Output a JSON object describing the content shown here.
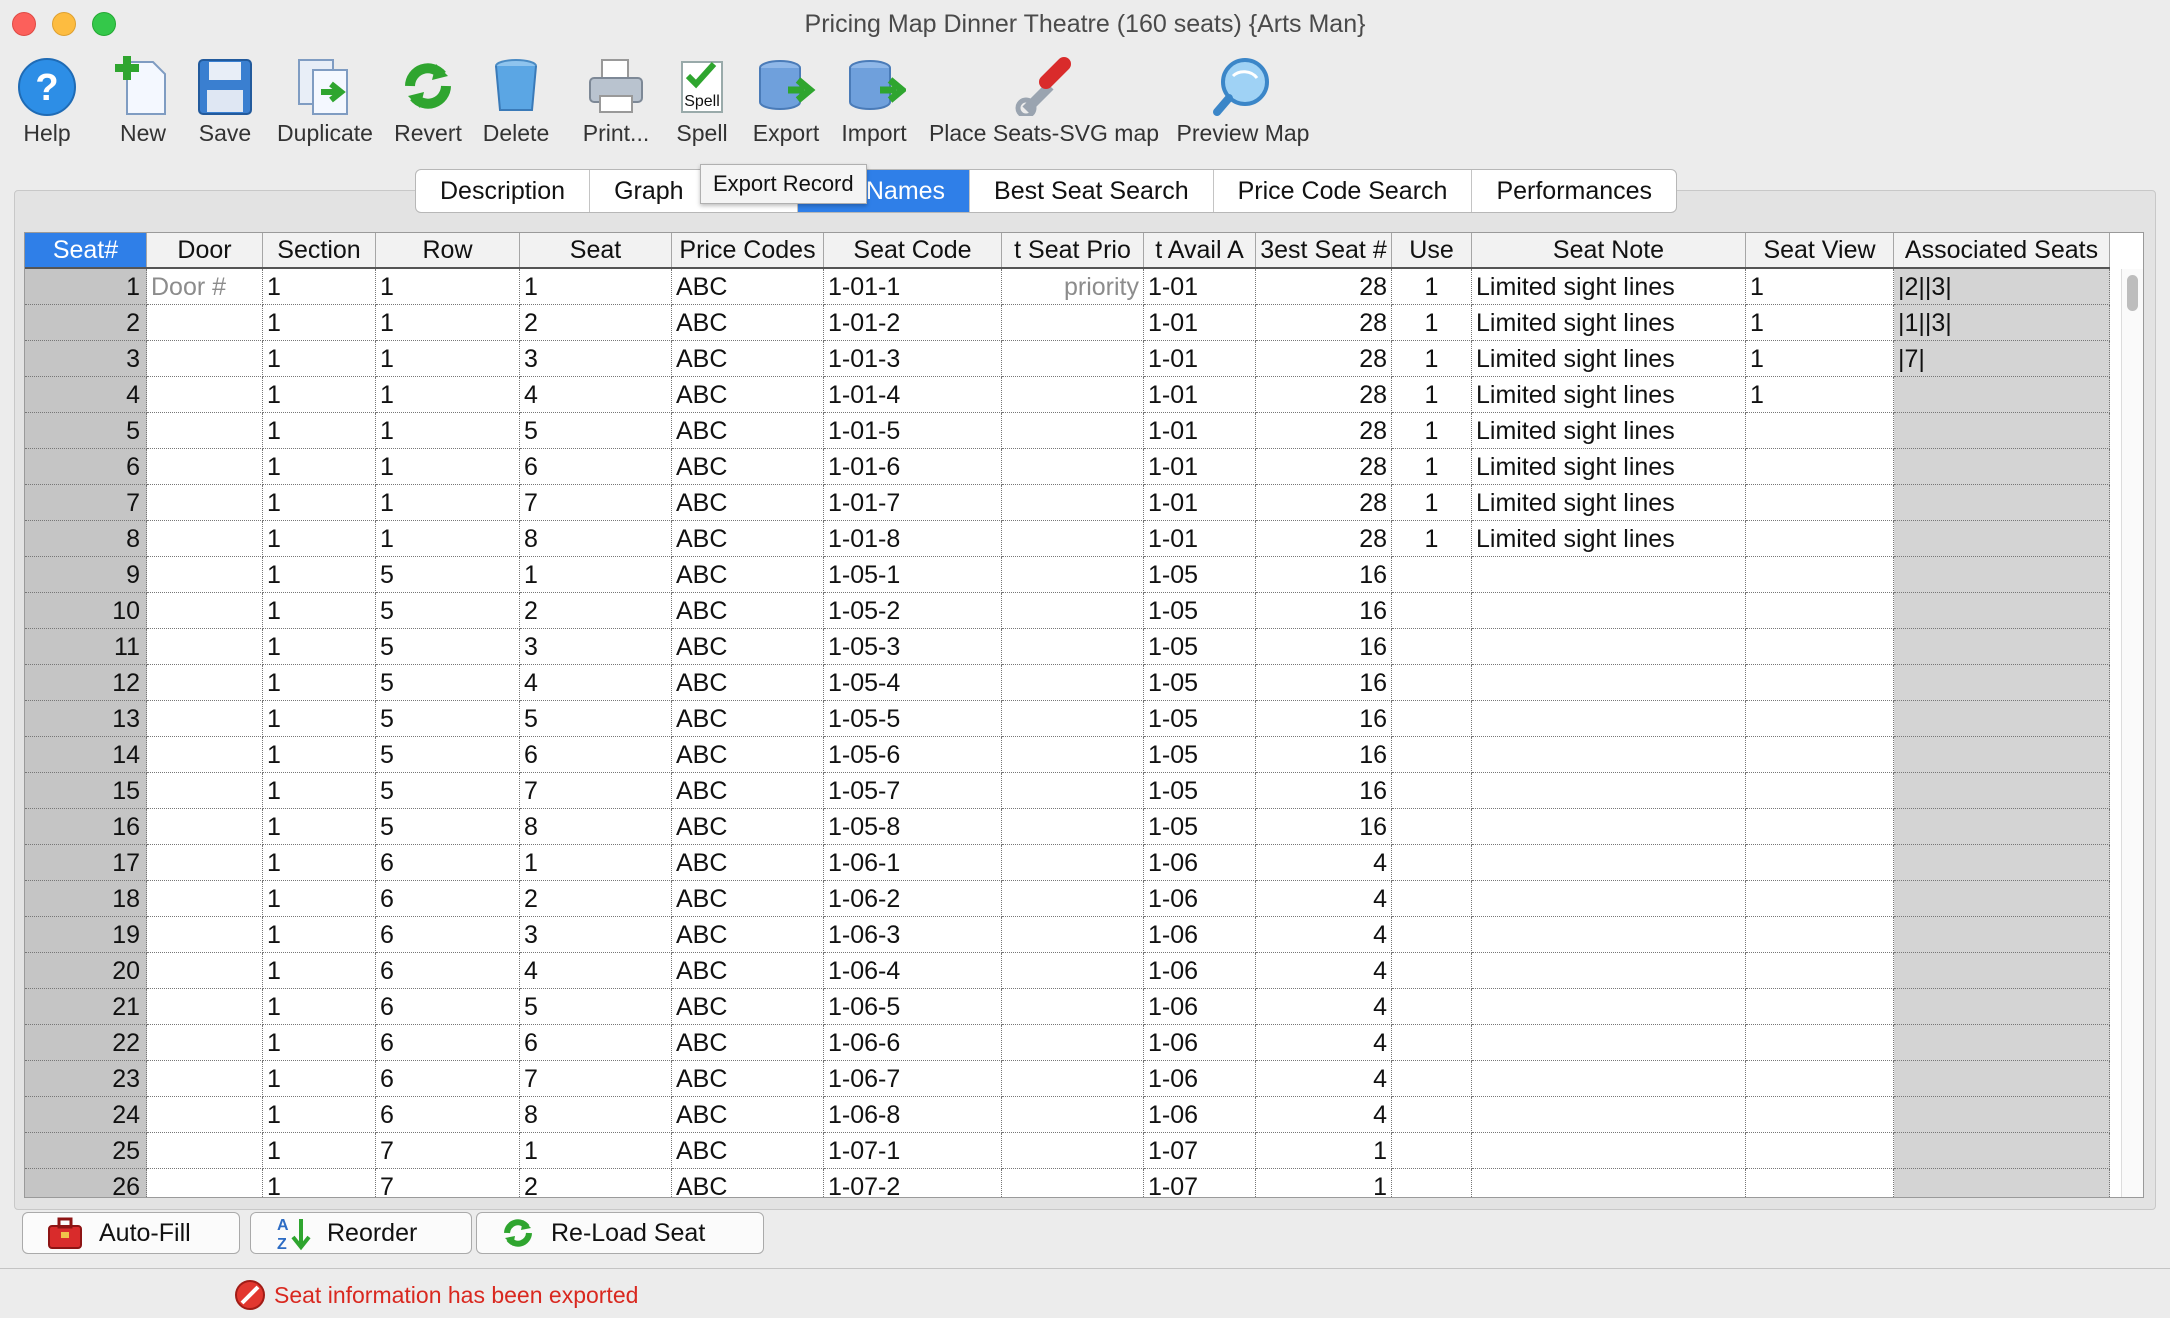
{
  "window": {
    "title": "Pricing Map Dinner Theatre (160 seats) {Arts Man}"
  },
  "toolbar": {
    "help": "Help",
    "new": "New",
    "save": "Save",
    "duplicate": "Duplicate",
    "revert": "Revert",
    "delete": "Delete",
    "print": "Print...",
    "spell": "Spell",
    "export": "Export",
    "import": "Import",
    "place_seats": "Place Seats-SVG map",
    "preview_map": "Preview Map",
    "spell_icon_text": "Spell"
  },
  "tabs": [
    "Description",
    "Graph",
    "Seat Names",
    "Best Seat Search",
    "Price Code Search",
    "Performances"
  ],
  "active_tab": "Seat Names",
  "tab_labels_visible": {
    "t0": "Description",
    "t1": "Graph",
    "t2": "at Names",
    "t3": "Best Seat Search",
    "t4": "Price Code Search",
    "t5": "Performances"
  },
  "tooltip": "Export Record",
  "grid": {
    "columns": [
      "Seat#",
      "Door",
      "Section",
      "Row",
      "Seat",
      "Price Codes",
      "Seat Code",
      "t Seat Prio",
      "t Avail A",
      "3est Seat #",
      "Use",
      "Seat Note",
      "Seat View",
      "Associated Seats"
    ],
    "placeholders": {
      "door": "Door #",
      "priority": "priority"
    },
    "rows": [
      [
        "1",
        "",
        "1",
        "1",
        "1",
        "ABC",
        "1-01-1",
        "",
        "1-01",
        "28",
        "1",
        "Limited sight lines",
        "1",
        "|2||3|"
      ],
      [
        "2",
        "",
        "1",
        "1",
        "2",
        "ABC",
        "1-01-2",
        "",
        "1-01",
        "28",
        "1",
        "Limited sight lines",
        "1",
        "|1||3|"
      ],
      [
        "3",
        "",
        "1",
        "1",
        "3",
        "ABC",
        "1-01-3",
        "",
        "1-01",
        "28",
        "1",
        "Limited sight lines",
        "1",
        "|7|"
      ],
      [
        "4",
        "",
        "1",
        "1",
        "4",
        "ABC",
        "1-01-4",
        "",
        "1-01",
        "28",
        "1",
        "Limited sight lines",
        "1",
        ""
      ],
      [
        "5",
        "",
        "1",
        "1",
        "5",
        "ABC",
        "1-01-5",
        "",
        "1-01",
        "28",
        "1",
        "Limited sight lines",
        "",
        ""
      ],
      [
        "6",
        "",
        "1",
        "1",
        "6",
        "ABC",
        "1-01-6",
        "",
        "1-01",
        "28",
        "1",
        "Limited sight lines",
        "",
        ""
      ],
      [
        "7",
        "",
        "1",
        "1",
        "7",
        "ABC",
        "1-01-7",
        "",
        "1-01",
        "28",
        "1",
        "Limited sight lines",
        "",
        ""
      ],
      [
        "8",
        "",
        "1",
        "1",
        "8",
        "ABC",
        "1-01-8",
        "",
        "1-01",
        "28",
        "1",
        "Limited sight lines",
        "",
        ""
      ],
      [
        "9",
        "",
        "1",
        "5",
        "1",
        "ABC",
        "1-05-1",
        "",
        "1-05",
        "16",
        "",
        "",
        "",
        ""
      ],
      [
        "10",
        "",
        "1",
        "5",
        "2",
        "ABC",
        "1-05-2",
        "",
        "1-05",
        "16",
        "",
        "",
        "",
        ""
      ],
      [
        "11",
        "",
        "1",
        "5",
        "3",
        "ABC",
        "1-05-3",
        "",
        "1-05",
        "16",
        "",
        "",
        "",
        ""
      ],
      [
        "12",
        "",
        "1",
        "5",
        "4",
        "ABC",
        "1-05-4",
        "",
        "1-05",
        "16",
        "",
        "",
        "",
        ""
      ],
      [
        "13",
        "",
        "1",
        "5",
        "5",
        "ABC",
        "1-05-5",
        "",
        "1-05",
        "16",
        "",
        "",
        "",
        ""
      ],
      [
        "14",
        "",
        "1",
        "5",
        "6",
        "ABC",
        "1-05-6",
        "",
        "1-05",
        "16",
        "",
        "",
        "",
        ""
      ],
      [
        "15",
        "",
        "1",
        "5",
        "7",
        "ABC",
        "1-05-7",
        "",
        "1-05",
        "16",
        "",
        "",
        "",
        ""
      ],
      [
        "16",
        "",
        "1",
        "5",
        "8",
        "ABC",
        "1-05-8",
        "",
        "1-05",
        "16",
        "",
        "",
        "",
        ""
      ],
      [
        "17",
        "",
        "1",
        "6",
        "1",
        "ABC",
        "1-06-1",
        "",
        "1-06",
        "4",
        "",
        "",
        "",
        ""
      ],
      [
        "18",
        "",
        "1",
        "6",
        "2",
        "ABC",
        "1-06-2",
        "",
        "1-06",
        "4",
        "",
        "",
        "",
        ""
      ],
      [
        "19",
        "",
        "1",
        "6",
        "3",
        "ABC",
        "1-06-3",
        "",
        "1-06",
        "4",
        "",
        "",
        "",
        ""
      ],
      [
        "20",
        "",
        "1",
        "6",
        "4",
        "ABC",
        "1-06-4",
        "",
        "1-06",
        "4",
        "",
        "",
        "",
        ""
      ],
      [
        "21",
        "",
        "1",
        "6",
        "5",
        "ABC",
        "1-06-5",
        "",
        "1-06",
        "4",
        "",
        "",
        "",
        ""
      ],
      [
        "22",
        "",
        "1",
        "6",
        "6",
        "ABC",
        "1-06-6",
        "",
        "1-06",
        "4",
        "",
        "",
        "",
        ""
      ],
      [
        "23",
        "",
        "1",
        "6",
        "7",
        "ABC",
        "1-06-7",
        "",
        "1-06",
        "4",
        "",
        "",
        "",
        ""
      ],
      [
        "24",
        "",
        "1",
        "6",
        "8",
        "ABC",
        "1-06-8",
        "",
        "1-06",
        "4",
        "",
        "",
        "",
        ""
      ],
      [
        "25",
        "",
        "1",
        "7",
        "1",
        "ABC",
        "1-07-1",
        "",
        "1-07",
        "1",
        "",
        "",
        "",
        ""
      ],
      [
        "26",
        "",
        "1",
        "7",
        "2",
        "ABC",
        "1-07-2",
        "",
        "1-07",
        "1",
        "",
        "",
        "",
        ""
      ]
    ]
  },
  "buttons": {
    "auto_fill": "Auto-Fill",
    "reorder": "Reorder",
    "reload_seat": "Re-Load Seat"
  },
  "status": "Seat information has been exported",
  "colors": {
    "accent": "#2f7fe8",
    "status": "#d9281f",
    "seat_col": "#c5c5c5"
  }
}
